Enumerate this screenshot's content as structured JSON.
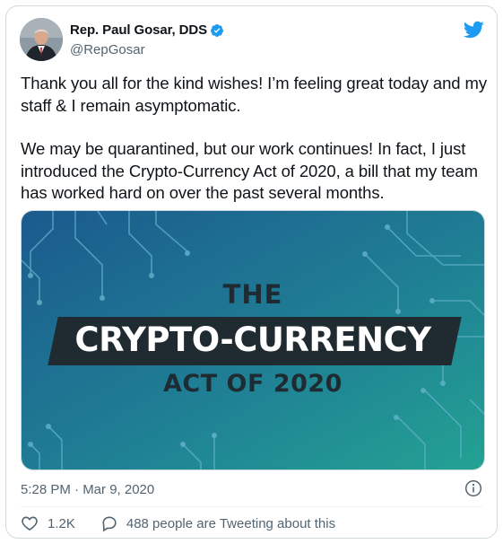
{
  "author": {
    "display_name": "Rep. Paul Gosar, DDS",
    "handle": "@RepGosar",
    "verified": true
  },
  "tweet": {
    "paragraphs": [
      "Thank you all for the kind wishes! I’m feeling great today and my staff & I remain asymptomatic.",
      "We may be quarantined, but our work continues! In fact, I just introduced the Crypto-Currency Act of 2020, a bill that my team has worked hard on over the past several months."
    ],
    "timestamp": "5:28 PM · Mar 9, 2020"
  },
  "media": {
    "line1": "THE",
    "line2": "CRYPTO-CURRENCY",
    "line3": "ACT OF 2020"
  },
  "engagement": {
    "likes": "1.2K",
    "discussion": "488 people are Tweeting about this"
  },
  "icons": {
    "brand": "twitter-bird-icon",
    "verified": "verified-badge-icon",
    "info": "info-icon",
    "like": "heart-icon",
    "discussion": "speech-bubble-icon"
  },
  "colors": {
    "brand_blue": "#1d9bf0",
    "text_primary": "#0f1419",
    "text_secondary": "#536471",
    "media_teal": "#1f8f95",
    "media_blue": "#1b5a8e"
  }
}
